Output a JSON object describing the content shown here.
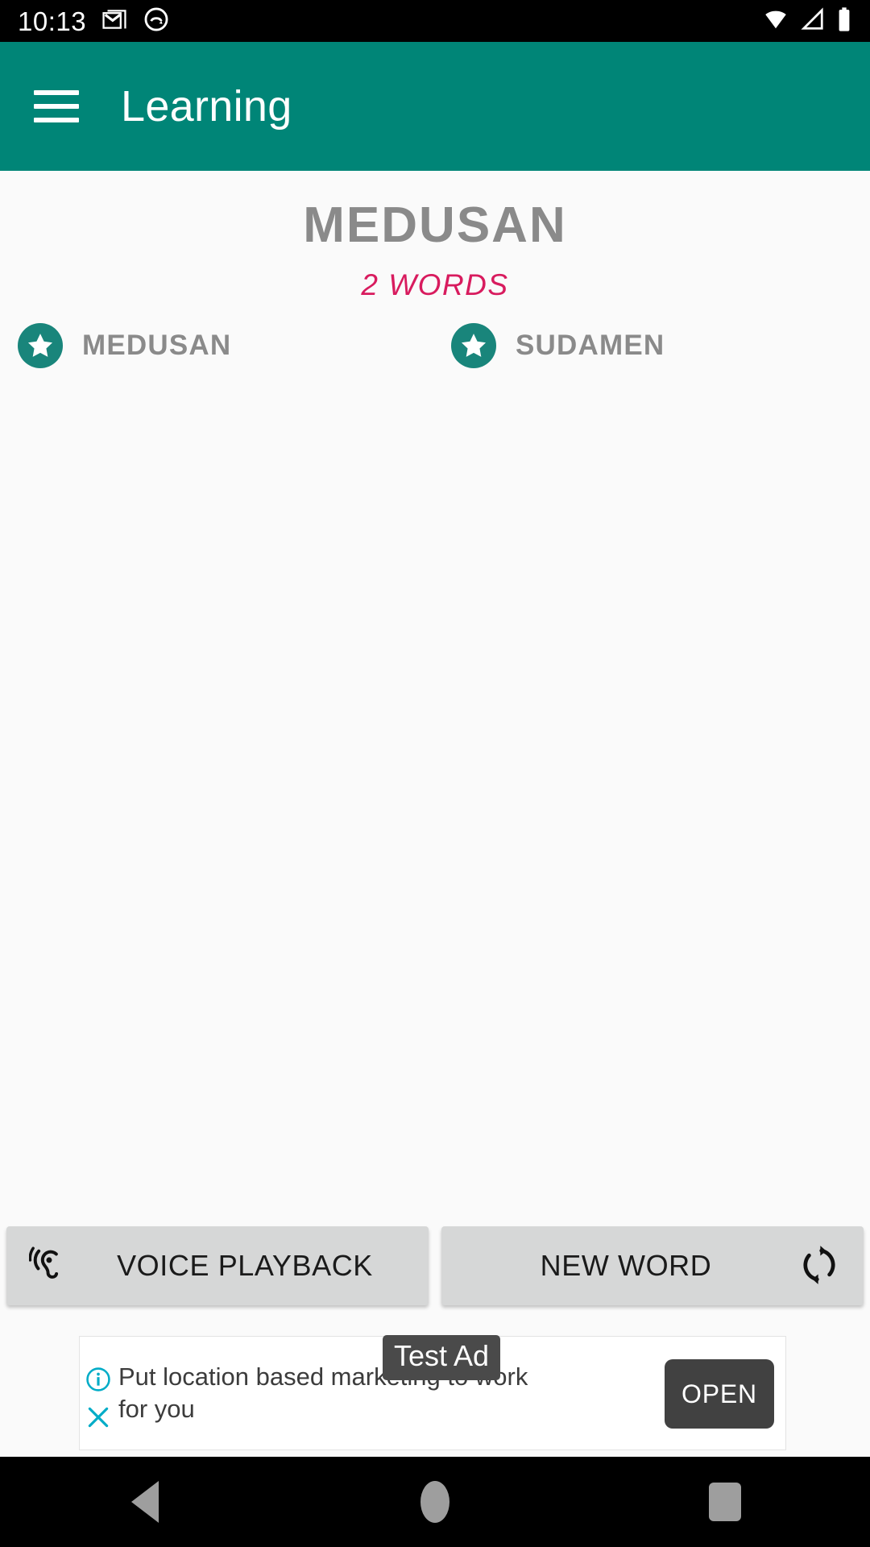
{
  "statusbar": {
    "clock": "10:13",
    "left_icons": [
      "gmail-icon",
      "notification-circle-icon"
    ],
    "right_icons": [
      "wifi-icon",
      "cell-signal-icon",
      "battery-icon"
    ]
  },
  "appbar": {
    "menu_icon": "hamburger-menu-icon",
    "title": "Learning",
    "background_color": "#008577"
  },
  "main": {
    "word_title": "MEDUSAN",
    "word_count_label": "2 WORDS",
    "word_count_color": "#D81B5E",
    "words": [
      {
        "label": "MEDUSAN",
        "icon": "star-circle-icon",
        "icon_color": "#19857B"
      },
      {
        "label": "SUDAMEN",
        "icon": "star-circle-icon",
        "icon_color": "#19857B"
      }
    ]
  },
  "actions": {
    "voice_playback_label": "VOICE PLAYBACK",
    "voice_playback_icon": "hearing-ear-icon",
    "new_word_label": "NEW WORD",
    "new_word_icon": "refresh-sync-icon"
  },
  "ad": {
    "badge_label": "Test Ad",
    "body_text": "Put location based marketing to work for you",
    "open_button_label": "OPEN",
    "info_icon": "info-circle-icon",
    "close_icon": "close-x-icon",
    "icon_color": "#00ACC7"
  },
  "navbar": {
    "back_icon": "back-triangle-icon",
    "home_icon": "home-circle-icon",
    "recents_icon": "recents-square-icon"
  }
}
